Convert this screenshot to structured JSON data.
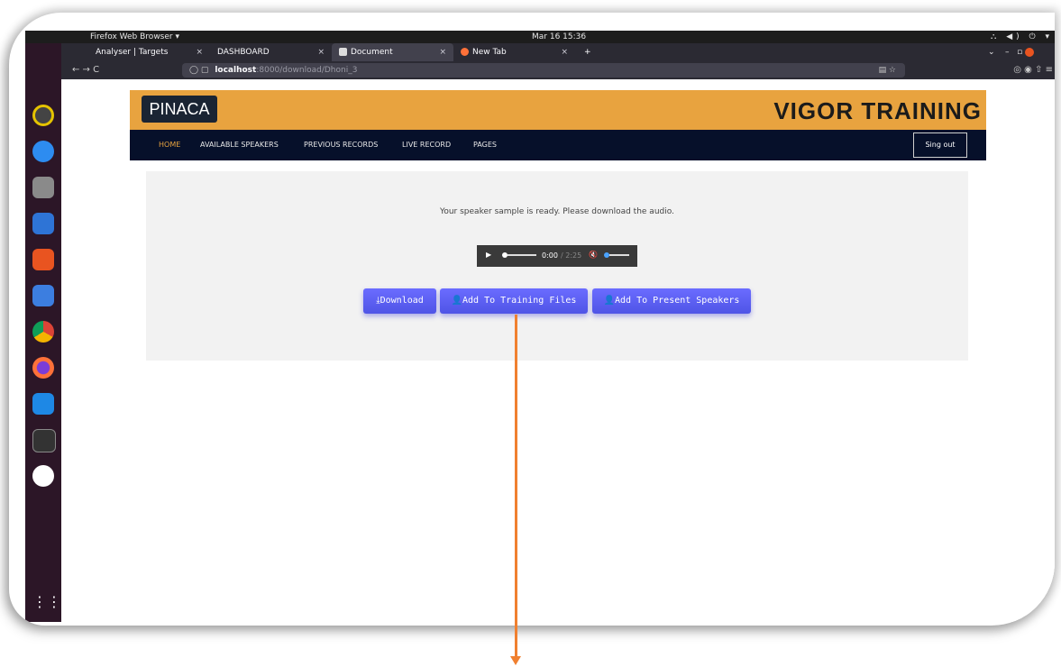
{
  "os": {
    "app_menu": "Firefox Web Browser ▾",
    "clock": "Mar 16  15:36",
    "tray": "⛬ ◀) ⏻ ▾"
  },
  "browser": {
    "tabs": [
      {
        "label": "Analyser | Targets"
      },
      {
        "label": "DASHBOARD"
      },
      {
        "label": "Document"
      },
      {
        "label": "New Tab"
      }
    ],
    "url_host": "localhost",
    "url_rest": ":8000/download/Dhoni_3"
  },
  "site": {
    "logo": "PINACA",
    "brand": "VIGOR TRAINING",
    "nav": [
      "HOME",
      "AVAILABLE SPEAKERS",
      "PREVIOUS RECORDS",
      "LIVE RECORD",
      "PAGES"
    ],
    "signout": "Sing out"
  },
  "main": {
    "message": "Your speaker sample is ready. Please download the audio.",
    "audio_time": "0:00",
    "audio_duration": "/ 2:25",
    "buttons": {
      "download": "⤓Download",
      "training": "👤Add To Training Files",
      "speakers": "👤Add To Present Speakers"
    }
  },
  "colors": {
    "header": "#e8a33f",
    "nav": "#06102a",
    "button": "#5a5ef0",
    "arrow": "#f08030"
  }
}
